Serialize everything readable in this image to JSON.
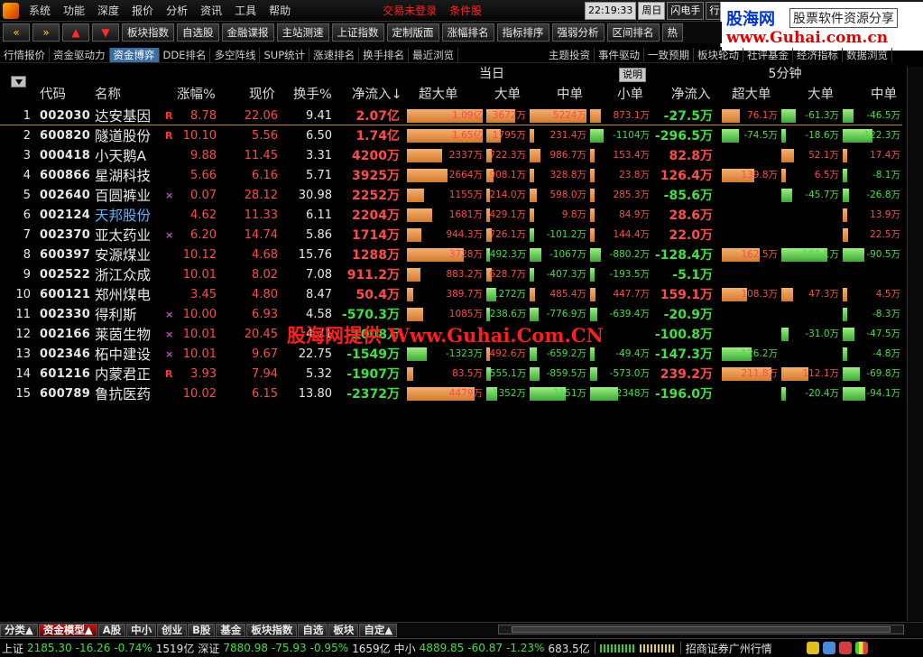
{
  "menu": [
    "系统",
    "功能",
    "深度",
    "报价",
    "分析",
    "资讯",
    "工具",
    "帮助"
  ],
  "menu_status": [
    "交易未登录",
    "条件股"
  ],
  "clock": {
    "time": "22:19:33",
    "weekday": "周日",
    "flash": "闪电手",
    "quote": "行情"
  },
  "brand": {
    "cn": "股海网",
    "tag": "股票软件资源分享",
    "url": "www.Guhai.com.cn"
  },
  "toolbar": {
    "nav": [
      "«",
      "»",
      "▲",
      "▼"
    ],
    "buttons": [
      "板块指数",
      "自选股",
      "金融谍报",
      "主站测速",
      "上证指数",
      "定制版面",
      "涨幅排名",
      "指标排序",
      "强弱分析",
      "区间排名",
      "热"
    ]
  },
  "subtabs": [
    "行情报价",
    "资金驱动力",
    "资金博弈",
    "DDE排名",
    "多空阵线",
    "SUP统计",
    "涨速排名",
    "换手排名",
    "最近浏览"
  ],
  "subtabs_right": [
    "主题投资",
    "事件驱动",
    "一致预期",
    "板块轮动",
    "社评基金",
    "经济指标",
    "数据浏览"
  ],
  "groups": {
    "today": "当日",
    "five_min": "5分钟",
    "explain": "说明"
  },
  "columns": [
    "代码",
    "名称",
    "涨幅%",
    "现价",
    "换手%",
    "净流入↓",
    "超大单",
    "大单",
    "中单",
    "小单",
    "净流入",
    "超大单",
    "大单",
    "中单"
  ],
  "rows": [
    {
      "n": "1",
      "code": "002030",
      "name": "达安基因",
      "flag": "R",
      "pct": "8.78",
      "price": "22.06",
      "turn": "9.41",
      "net": "2.07亿",
      "sl": "1.09亿",
      "lg": "3672万",
      "md": "5224万",
      "sm": "873.1万",
      "net5": "-27.5万",
      "sl5": "76.1万",
      "lg5": "-61.3万",
      "md5": "-46.5万"
    },
    {
      "n": "2",
      "code": "600820",
      "name": "隧道股份",
      "flag": "R",
      "pct": "10.10",
      "price": "5.56",
      "turn": "6.50",
      "net": "1.74亿",
      "sl": "1.65亿",
      "lg": "1795万",
      "md": "231.4万",
      "sm": "-1104万",
      "net5": "-296.5万",
      "sl5": "-74.5万",
      "lg5": "-18.6万",
      "md5": "-122.3万"
    },
    {
      "n": "3",
      "code": "000418",
      "name": "小天鹅A",
      "flag": "",
      "pct": "9.88",
      "price": "11.45",
      "turn": "3.31",
      "net": "4200万",
      "sl": "2337万",
      "lg": "722.3万",
      "md": "986.7万",
      "sm": "153.4万",
      "net5": "82.8万",
      "sl5": "",
      "lg5": "52.1万",
      "md5": "17.4万"
    },
    {
      "n": "4",
      "code": "600866",
      "name": "星湖科技",
      "flag": "",
      "pct": "5.66",
      "price": "6.16",
      "turn": "5.71",
      "net": "3925万",
      "sl": "2664万",
      "lg": "908.1万",
      "md": "328.8万",
      "sm": "23.8万",
      "net5": "126.4万",
      "sl5": "139.8万",
      "lg5": "6.5万",
      "md5": "-8.1万"
    },
    {
      "n": "5",
      "code": "002640",
      "name": "百圆裤业",
      "flag": "×",
      "pct": "0.07",
      "price": "28.12",
      "turn": "30.98",
      "net": "2252万",
      "sl": "1155万",
      "lg": "214.0万",
      "md": "598.0万",
      "sm": "285.3万",
      "net5": "-85.6万",
      "sl5": "",
      "lg5": "-45.7万",
      "md5": "-26.8万"
    },
    {
      "n": "6",
      "code": "002124",
      "name": "天邦股份",
      "flag": "",
      "pct": "4.62",
      "price": "11.33",
      "turn": "6.11",
      "net": "2204万",
      "sl": "1681万",
      "lg": "429.1万",
      "md": "9.8万",
      "sm": "84.9万",
      "net5": "28.6万",
      "sl5": "",
      "lg5": "",
      "md5": "13.9万"
    },
    {
      "n": "7",
      "code": "002370",
      "name": "亚太药业",
      "flag": "×",
      "pct": "6.20",
      "price": "14.74",
      "turn": "5.86",
      "net": "1714万",
      "sl": "944.3万",
      "lg": "726.1万",
      "md": "-101.2万",
      "sm": "144.4万",
      "net5": "22.0万",
      "sl5": "",
      "lg5": "",
      "md5": "22.5万"
    },
    {
      "n": "8",
      "code": "600397",
      "name": "安源煤业",
      "flag": "",
      "pct": "10.12",
      "price": "4.68",
      "turn": "15.76",
      "net": "1288万",
      "sl": "3728万",
      "lg": "-492.3万",
      "md": "-1067万",
      "sm": "-880.2万",
      "net5": "-128.4万",
      "sl5": "162.5万",
      "lg5": "-191.1万",
      "md5": "-90.5万"
    },
    {
      "n": "9",
      "code": "002522",
      "name": "浙江众成",
      "flag": "",
      "pct": "10.01",
      "price": "8.02",
      "turn": "7.08",
      "net": "911.2万",
      "sl": "883.2万",
      "lg": "628.7万",
      "md": "-407.3万",
      "sm": "-193.5万",
      "net5": "-5.1万",
      "sl5": "",
      "lg5": "",
      "md5": ""
    },
    {
      "n": "10",
      "code": "600121",
      "name": "郑州煤电",
      "flag": "",
      "pct": "3.45",
      "price": "4.80",
      "turn": "8.47",
      "net": "50.4万",
      "sl": "389.7万",
      "lg": "-1272万",
      "md": "485.4万",
      "sm": "447.7万",
      "net5": "159.1万",
      "sl5": "108.3万",
      "lg5": "47.3万",
      "md5": "4.5万"
    },
    {
      "n": "11",
      "code": "002330",
      "name": "得利斯",
      "flag": "×",
      "pct": "10.00",
      "price": "6.93",
      "turn": "4.58",
      "net": "-570.3万",
      "sl": "1085万",
      "lg": "-238.6万",
      "md": "-776.9万",
      "sm": "-639.4万",
      "net5": "-20.9万",
      "sl5": "",
      "lg5": "",
      "md5": "-8.3万"
    },
    {
      "n": "12",
      "code": "002166",
      "name": "莱茵生物",
      "flag": "×",
      "pct": "10.01",
      "price": "20.45",
      "turn": "4.71",
      "net": "-1008万",
      "sl": "",
      "lg": "",
      "md": "",
      "sm": "",
      "net5": "-100.8万",
      "sl5": "",
      "lg5": "-31.0万",
      "md5": "-47.5万"
    },
    {
      "n": "13",
      "code": "002346",
      "name": "柘中建设",
      "flag": "×",
      "pct": "10.01",
      "price": "9.67",
      "turn": "22.75",
      "net": "-1549万",
      "sl": "-1323万",
      "lg": "492.6万",
      "md": "-659.2万",
      "sm": "-49.4万",
      "net5": "-147.3万",
      "sl5": "-126.2万",
      "lg5": "",
      "md5": "-4.8万"
    },
    {
      "n": "14",
      "code": "601216",
      "name": "内蒙君正",
      "flag": "R",
      "pct": "3.93",
      "price": "7.94",
      "turn": "5.32",
      "net": "-1907万",
      "sl": "83.5万",
      "lg": "-555.1万",
      "md": "-859.5万",
      "sm": "-573.0万",
      "net5": "239.2万",
      "sl5": "211.8万",
      "lg5": "112.1万",
      "md5": "-69.8万"
    },
    {
      "n": "15",
      "code": "600789",
      "name": "鲁抗医药",
      "flag": "",
      "pct": "10.02",
      "price": "6.15",
      "turn": "13.80",
      "net": "-2372万",
      "sl": "4479万",
      "lg": "-1352万",
      "md": "-3151万",
      "sm": "-2348万",
      "net5": "-196.0万",
      "sl5": "",
      "lg5": "-20.4万",
      "md5": "-94.1万"
    }
  ],
  "watermark": "股海网提供 Www.Guhai.Com.CN",
  "bottom_tabs": [
    "分类▲",
    "资金模型▲",
    "A股",
    "中小",
    "创业",
    "B股",
    "基金",
    "板块指数",
    "自选",
    "板块",
    "自定▲"
  ],
  "status": {
    "sh": {
      "label": "上证",
      "val": "2185.30",
      "chg": "-16.26",
      "pct": "-0.74%",
      "amt": "1519亿"
    },
    "sz": {
      "label": "深证",
      "val": "7880.98",
      "chg": "-75.93",
      "pct": "-0.95%",
      "amt": "1659亿"
    },
    "zx": {
      "label": "中小",
      "val": "4889.85",
      "chg": "-60.87",
      "pct": "-1.23%",
      "amt": "683.5亿"
    },
    "broker": "招商证券广州行情"
  },
  "colors": {
    "up": "#ff4a4a",
    "down": "#40e040",
    "orange_bar": "#e08a3c",
    "green_bar": "#5cc850",
    "active_tab": "#3a6ea5"
  }
}
